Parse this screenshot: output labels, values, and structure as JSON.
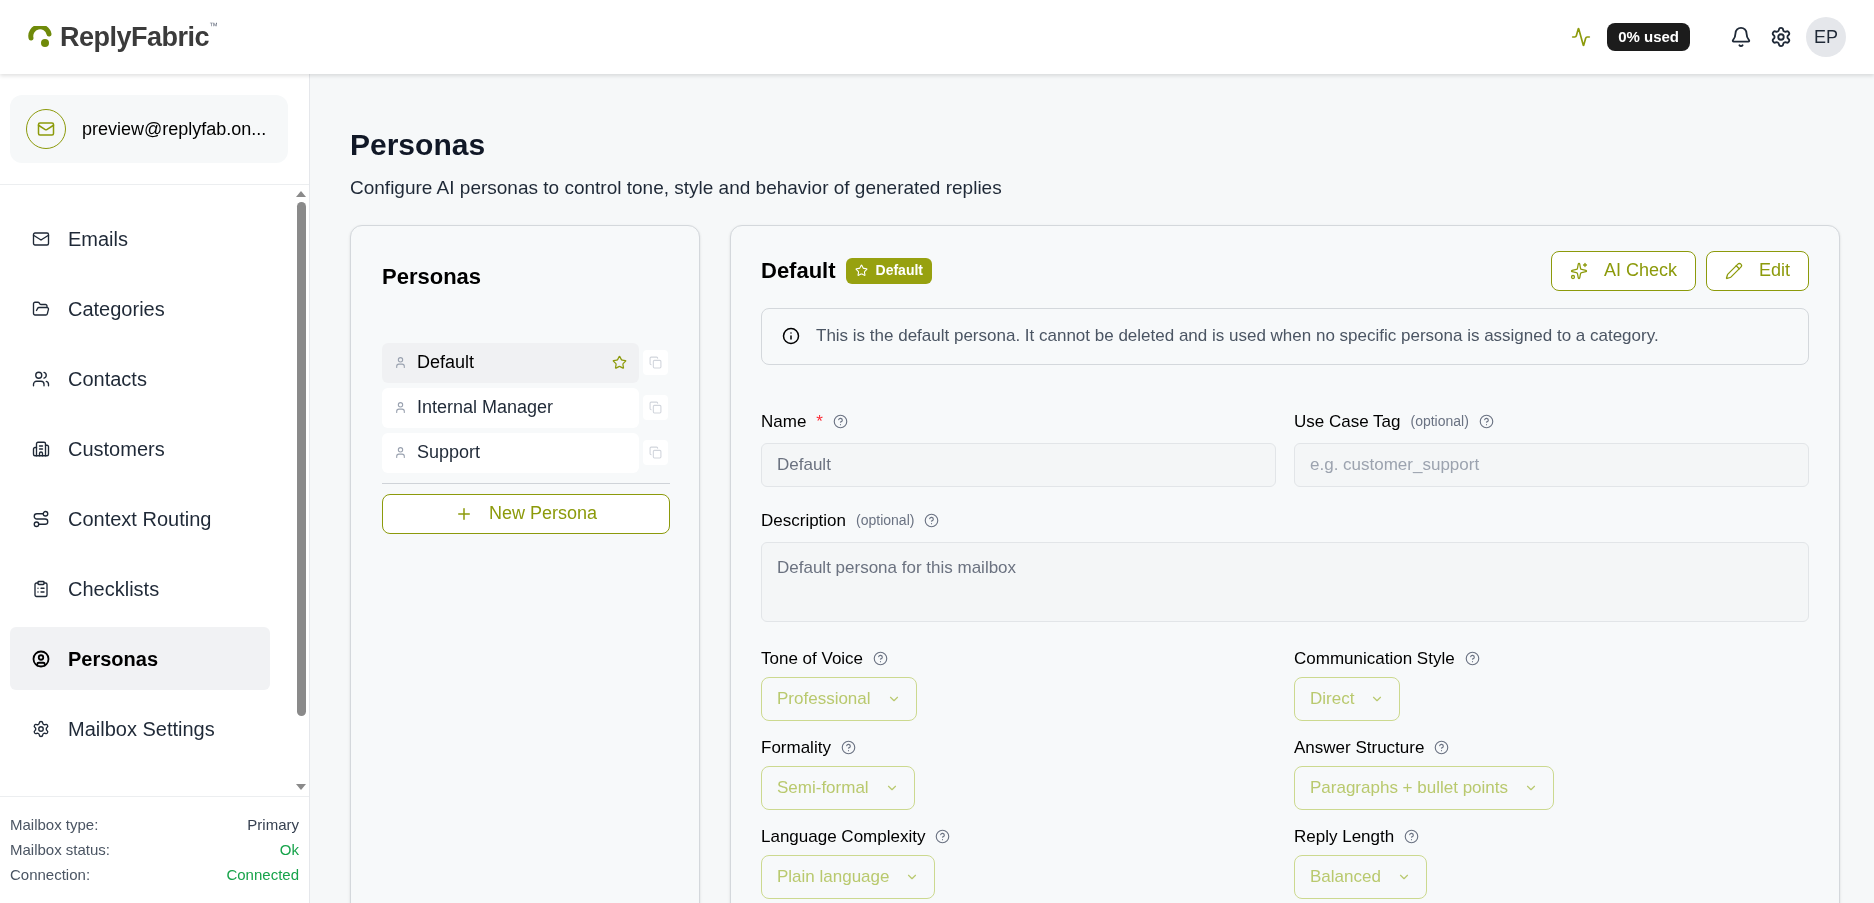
{
  "header": {
    "logo": "ReplyFabric",
    "logo_mark": "™",
    "usage": "0% used",
    "avatar": "EP"
  },
  "sidebar": {
    "account": "preview@replyfab.on...",
    "nav": [
      {
        "label": "Emails",
        "selected": false
      },
      {
        "label": "Categories",
        "selected": false
      },
      {
        "label": "Contacts",
        "selected": false
      },
      {
        "label": "Customers",
        "selected": false
      },
      {
        "label": "Context Routing",
        "selected": false
      },
      {
        "label": "Checklists",
        "selected": false
      },
      {
        "label": "Personas",
        "selected": true
      },
      {
        "label": "Mailbox Settings",
        "selected": false
      }
    ],
    "footer": [
      {
        "label": "Mailbox type:",
        "value": "Primary",
        "kind": "plain"
      },
      {
        "label": "Mailbox status:",
        "value": "Ok",
        "kind": "ok"
      },
      {
        "label": "Connection:",
        "value": "Connected",
        "kind": "ok"
      }
    ]
  },
  "page": {
    "title": "Personas",
    "subtitle": "Configure AI personas to control tone, style and behavior of generated replies"
  },
  "persona_list": {
    "title": "Personas",
    "items": [
      {
        "name": "Default",
        "selected": true,
        "default": true
      },
      {
        "name": "Internal Manager",
        "selected": false,
        "default": false
      },
      {
        "name": "Support",
        "selected": false,
        "default": false
      }
    ],
    "new_button": "New Persona"
  },
  "detail": {
    "title": "Default",
    "badge": "Default",
    "buttons": [
      "AI Check",
      "Edit"
    ],
    "info": "This is the default persona. It cannot be deleted and is used when no specific persona is assigned to a category.",
    "text_fields": [
      {
        "label": "Name",
        "required_mark": "*",
        "value": "Default",
        "disabled": true
      },
      {
        "label": "Use Case Tag",
        "hint": "(optional)",
        "placeholder": "e.g. customer_support",
        "disabled": true
      }
    ],
    "description": {
      "label": "Description",
      "hint": "(optional)",
      "value": "Default persona for this mailbox",
      "disabled": true
    },
    "selects": [
      {
        "label": "Tone of Voice",
        "value": "Professional",
        "disabled": true
      },
      {
        "label": "Communication Style",
        "value": "Direct",
        "disabled": true
      },
      {
        "label": "Formality",
        "value": "Semi-formal",
        "disabled": true
      },
      {
        "label": "Answer Structure",
        "value": "Paragraphs + bullet points",
        "disabled": true
      },
      {
        "label": "Language Complexity",
        "value": "Plain language",
        "disabled": true
      },
      {
        "label": "Reply Length",
        "value": "Balanced",
        "disabled": true
      }
    ]
  }
}
